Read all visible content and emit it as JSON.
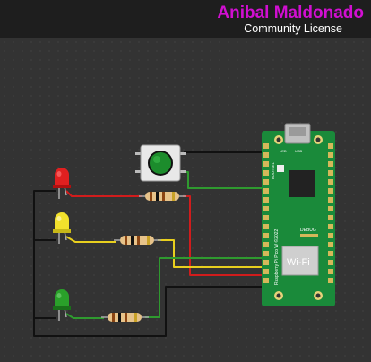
{
  "header": {
    "author": "Anibal Maldonado",
    "license": "Community License"
  },
  "board": {
    "name": "Raspberry Pi Pico W ©2022",
    "wifi_label": "Wi-Fi",
    "debug_label": "DEBUG",
    "led_label": "LED",
    "usb_label": "USB",
    "bootsel_label": "BOOTSEL"
  },
  "components": {
    "leds": [
      {
        "color": "red",
        "hex": "#e02020"
      },
      {
        "color": "yellow",
        "hex": "#f2e12c"
      },
      {
        "color": "green",
        "hex": "#2aa02a"
      }
    ],
    "resistor_count": 3,
    "pushbutton": "pushbutton"
  },
  "colors": {
    "background": "#333333",
    "topbar": "#1e1e1e",
    "author": "#d10fd1",
    "board": "#1a8a3a",
    "wire_red": "#d11c1c",
    "wire_yellow": "#e8cf1e",
    "wire_green": "#2f9a2f",
    "wire_black": "#111111"
  }
}
